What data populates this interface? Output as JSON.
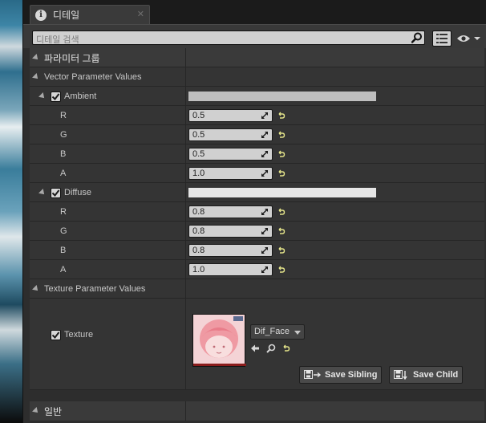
{
  "tab": {
    "label": "디테일",
    "icon": "info-icon"
  },
  "search": {
    "placeholder": "디테일 검색"
  },
  "categories": {
    "params": "파라미터 그룹",
    "general": "일반"
  },
  "vector": {
    "header": "Vector Parameter Values",
    "params": [
      {
        "name": "Ambient",
        "checked": true,
        "color": "#bfbfbf",
        "channels": [
          {
            "label": "R",
            "value": "0.5"
          },
          {
            "label": "G",
            "value": "0.5"
          },
          {
            "label": "B",
            "value": "0.5"
          },
          {
            "label": "A",
            "value": "1.0"
          }
        ]
      },
      {
        "name": "Diffuse",
        "checked": true,
        "color": "#e6e6e6",
        "channels": [
          {
            "label": "R",
            "value": "0.8"
          },
          {
            "label": "G",
            "value": "0.8"
          },
          {
            "label": "B",
            "value": "0.8"
          },
          {
            "label": "A",
            "value": "1.0"
          }
        ]
      }
    ]
  },
  "texture": {
    "header": "Texture Parameter Values",
    "label": "Texture",
    "checked": true,
    "asset": "Dif_Face"
  },
  "buttons": {
    "save_sibling": "Save Sibling",
    "save_child": "Save Child"
  }
}
